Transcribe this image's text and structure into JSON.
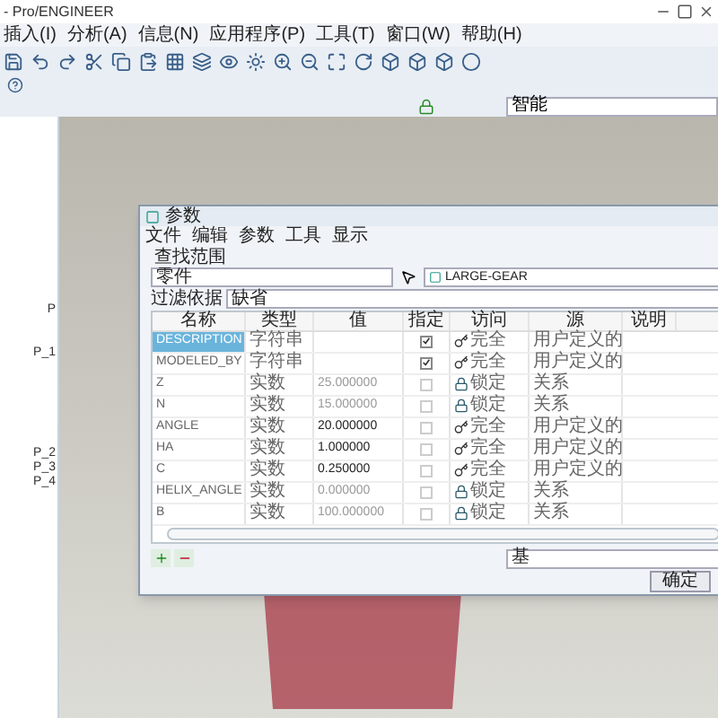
{
  "window": {
    "title": "- Pro/ENGINEER"
  },
  "menu": [
    "插入(I)",
    "分析(A)",
    "信息(N)",
    "应用程序(P)",
    "工具(T)",
    "窗口(W)",
    "帮助(H)"
  ],
  "filter_dropdown": {
    "value": "智能"
  },
  "model_tree": {
    "items": [
      "P",
      "P_1",
      "P_2",
      "P_3",
      "P_4"
    ]
  },
  "dialog": {
    "title": "参数",
    "menu": [
      "文件",
      "编辑",
      "参数",
      "工具",
      "显示"
    ],
    "lookup_label": "查找范围",
    "scope": {
      "value": "零件"
    },
    "model": {
      "value": "LARGE-GEAR"
    },
    "filter_label": "过滤依据",
    "filter": {
      "value": "缺省"
    },
    "table": {
      "columns": [
        "名称",
        "类型",
        "值",
        "指定",
        "访问",
        "源",
        "说明"
      ],
      "rows": [
        {
          "name": "DESCRIPTION",
          "type": "字符串",
          "value": "",
          "designate": true,
          "access": "完全",
          "kind": "full",
          "source": "用户定义的",
          "selected": true
        },
        {
          "name": "MODELED_BY",
          "type": "字符串",
          "value": "",
          "designate": true,
          "access": "完全",
          "kind": "full",
          "source": "用户定义的",
          "selected": false
        },
        {
          "name": "Z",
          "type": "实数",
          "value": "25.000000",
          "designate": false,
          "access": "锁定",
          "kind": "locked",
          "source": "关系",
          "selected": false
        },
        {
          "name": "N",
          "type": "实数",
          "value": "15.000000",
          "designate": false,
          "access": "锁定",
          "kind": "locked",
          "source": "关系",
          "selected": false
        },
        {
          "name": "ANGLE",
          "type": "实数",
          "value": "20.000000",
          "designate": false,
          "access": "完全",
          "kind": "full",
          "source": "用户定义的",
          "selected": false
        },
        {
          "name": "HA",
          "type": "实数",
          "value": "1.000000",
          "designate": false,
          "access": "完全",
          "kind": "full",
          "source": "用户定义的",
          "selected": false
        },
        {
          "name": "C",
          "type": "实数",
          "value": "0.250000",
          "designate": false,
          "access": "完全",
          "kind": "full",
          "source": "用户定义的",
          "selected": false
        },
        {
          "name": "HELIX_ANGLE",
          "type": "实数",
          "value": "0.000000",
          "designate": false,
          "access": "锁定",
          "kind": "locked",
          "source": "关系",
          "selected": false
        },
        {
          "name": "B",
          "type": "实数",
          "value": "100.000000",
          "designate": false,
          "access": "锁定",
          "kind": "locked",
          "source": "关系",
          "selected": false
        }
      ]
    },
    "view": {
      "value": "基"
    },
    "ok_button": "确定"
  }
}
